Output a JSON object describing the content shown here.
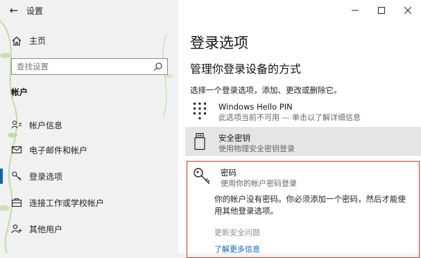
{
  "window": {
    "title": "设置"
  },
  "sidebar": {
    "home_label": "主页",
    "search_placeholder": "查找设置",
    "section_label": "帐户",
    "items": [
      {
        "label": "帐户信息",
        "icon": "person-icon"
      },
      {
        "label": "电子邮件和帐户",
        "icon": "mail-icon"
      },
      {
        "label": "登录选项",
        "icon": "key-icon",
        "active": true
      },
      {
        "label": "连接工作或学校帐户",
        "icon": "briefcase-icon"
      },
      {
        "label": "其他用户",
        "icon": "add-person-icon"
      }
    ]
  },
  "main": {
    "title": "登录选项",
    "subtitle": "管理你登录设备的方式",
    "instruction": "选择一个登录选项，添加、更改或删除它。",
    "options": [
      {
        "title": "Windows Hello PIN",
        "desc": "此选项当前不可用 — 单击以了解详细信息",
        "icon": "keypad-icon"
      },
      {
        "title": "安全密钥",
        "desc": "使用物理安全密钥登录",
        "icon": "usb-key-icon"
      },
      {
        "title": "密码",
        "desc": "使用你的帐户密码登录",
        "icon": "key-icon"
      }
    ],
    "password_panel": {
      "message": "你的帐户没有密码。你必须添加一个密码，然后才能使用其他登录选项。",
      "update_link": "更新安全问题",
      "learn_more": "了解更多信息"
    }
  },
  "colors": {
    "accent": "#0067c0",
    "highlight_border": "#c0392b",
    "selected_bg": "#e5e5e5"
  }
}
